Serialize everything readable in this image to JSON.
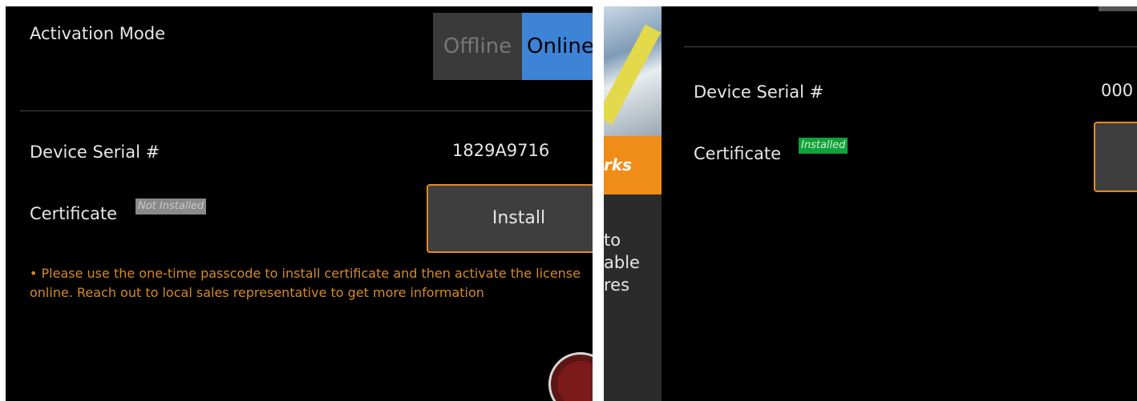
{
  "left": {
    "activation_mode_label": "Activation Mode",
    "toggle": {
      "off_label": "Offline",
      "on_label": "Online",
      "selected": "Online"
    },
    "device_serial_label": "Device Serial #",
    "device_serial_value": "1829A9716",
    "certificate_label": "Certificate",
    "certificate_status": "Not Installed",
    "install_button_label": "Install",
    "note": "• Please use the one-time passcode to install certificate and then activate the license online. Reach out to local sales representative to get more information"
  },
  "right": {
    "side_banner_text": "rks",
    "side_text_lines": [
      "to",
      "able",
      "res"
    ],
    "device_serial_label": "Device Serial #",
    "device_serial_value": "000",
    "certificate_label": "Certificate",
    "certificate_status": "Installed"
  },
  "colors": {
    "accent_orange": "#e58a1f",
    "toggle_blue": "#3d83d6",
    "installed_green": "#12a13a",
    "not_installed_gray": "#8a8a8a"
  }
}
